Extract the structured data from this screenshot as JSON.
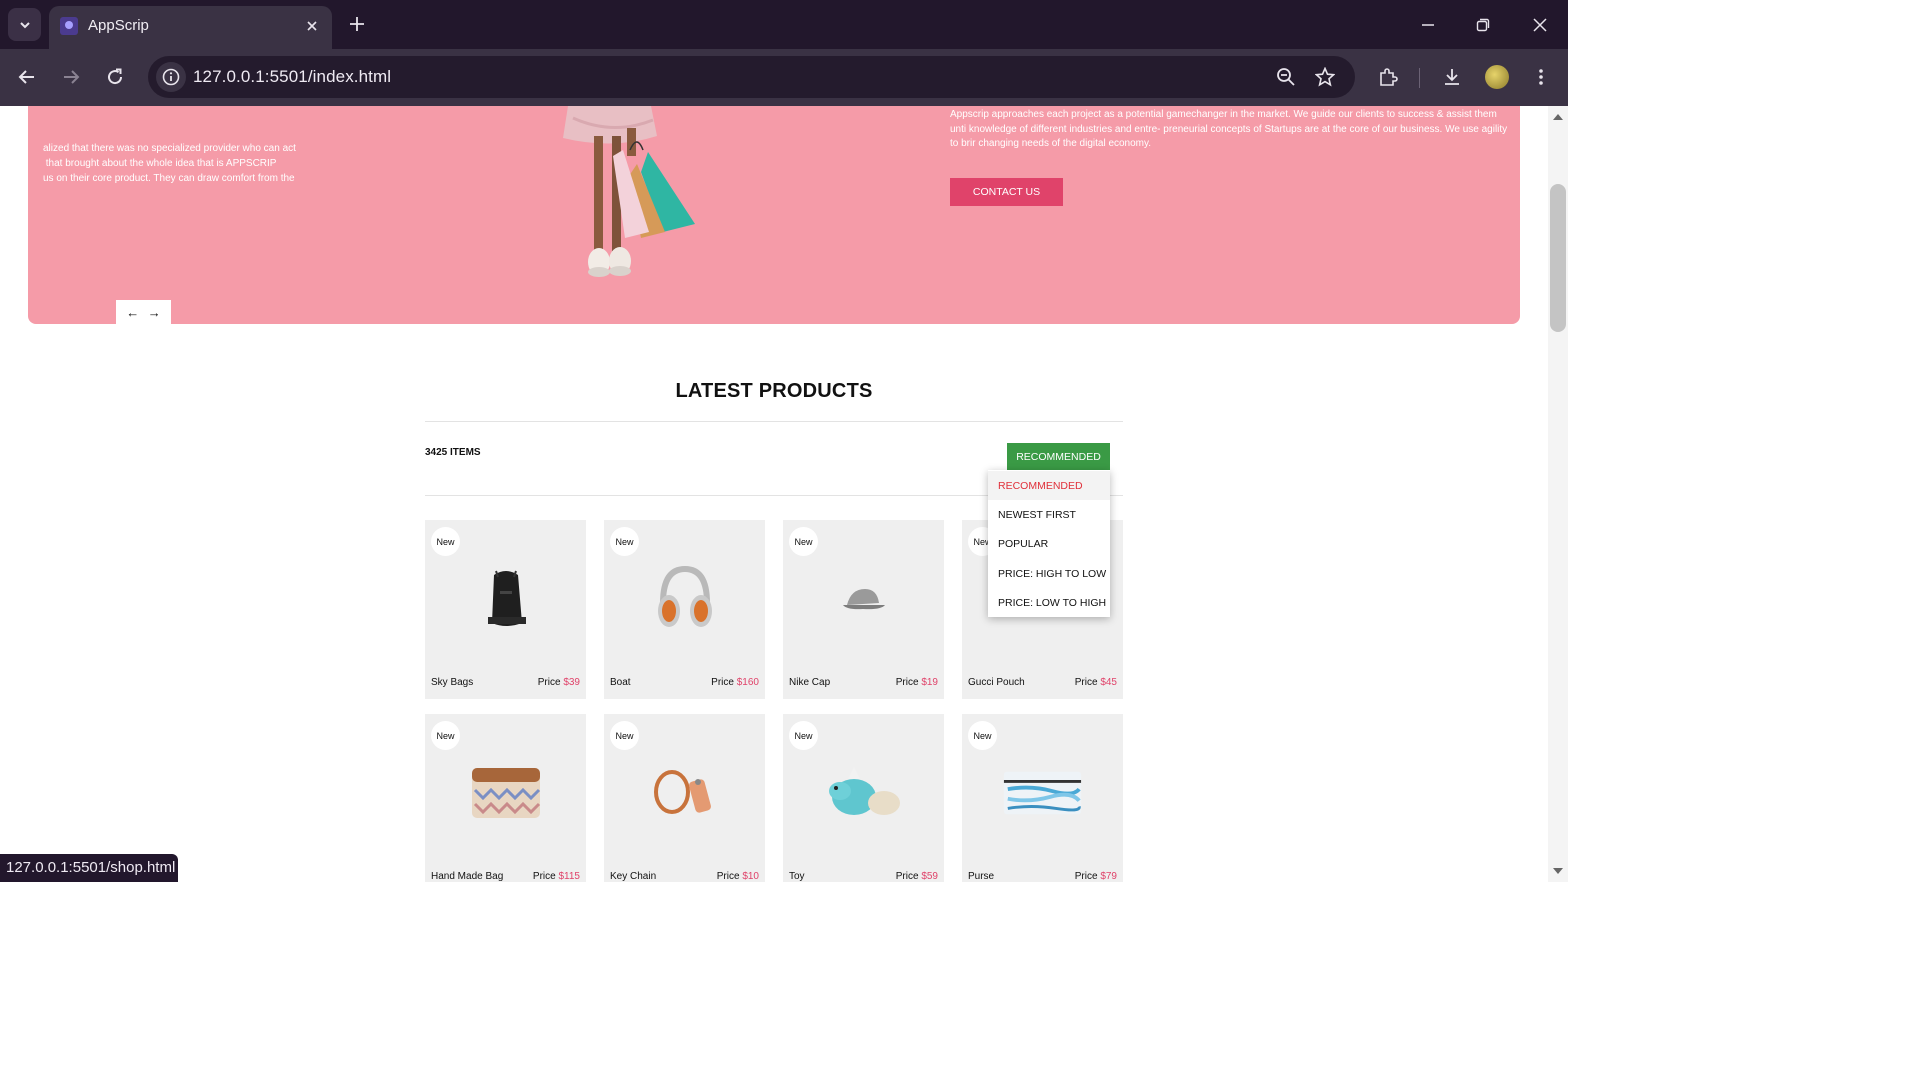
{
  "browser": {
    "tab_title": "AppScrip",
    "url": "127.0.0.1:5501/index.html",
    "status_url": "127.0.0.1:5501/shop.html"
  },
  "hero": {
    "left_text": "alized that there was no specialized provider who can act\n that brought about the whole idea that is APPSCRIP\nus on their core product. They can draw comfort from the",
    "right_text": "Appscrip approaches each project as a potential gamechanger in the market. We guide our clients to success & assist them unti knowledge of different industries and entre- preneurial concepts of Startups are at the core of our business. We use agility to brir changing needs of the digital economy.",
    "contact_label": "CONTACT US",
    "prev_arrow": "←",
    "next_arrow": "→"
  },
  "products": {
    "title": "LATEST PRODUCTS",
    "count_label": "3425 ITEMS",
    "sort_label": "RECOMMENDED",
    "sort_options": [
      "RECOMMENDED",
      "NEWEST FIRST",
      "POPULAR",
      "PRICE: HIGH TO LOW",
      "PRICE: LOW TO HIGH"
    ],
    "price_prefix": "Price",
    "items": [
      {
        "badge": "New",
        "name": "Sky Bags",
        "price": "$39"
      },
      {
        "badge": "New",
        "name": "Boat",
        "price": "$160"
      },
      {
        "badge": "New",
        "name": "Nike Cap",
        "price": "$19"
      },
      {
        "badge": "New",
        "name": "Gucci Pouch",
        "price": "$45"
      },
      {
        "badge": "New",
        "name": "Hand Made Bag",
        "price": "$115"
      },
      {
        "badge": "New",
        "name": "Key Chain",
        "price": "$10"
      },
      {
        "badge": "New",
        "name": "Toy",
        "price": "$59"
      },
      {
        "badge": "New",
        "name": "Purse",
        "price": "$79"
      }
    ]
  },
  "colors": {
    "hero_bg": "#f59ba8",
    "accent_pink": "#e0436a",
    "sort_green": "#3a9a45",
    "active_red": "#e0303a"
  }
}
